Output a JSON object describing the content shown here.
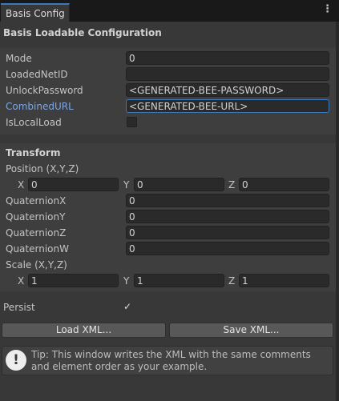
{
  "window": {
    "tab_title": "Basis Config",
    "menu_icon": "kebab-menu-icon"
  },
  "header": {
    "title": "Basis Loadable Configuration"
  },
  "loadable": {
    "mode_label": "Mode",
    "mode_value": "0",
    "net_id_label": "LoadedNetID",
    "net_id_value": "",
    "unlock_label": "UnlockPassword",
    "unlock_value": "<GENERATED-BEE-PASSWORD>",
    "url_label": "CombinedURL",
    "url_value": "<GENERATED-BEE-URL>",
    "local_label": "IsLocalLoad",
    "local_checked": false
  },
  "transform": {
    "title": "Transform",
    "position_label": "Position (X,Y,Z)",
    "position": {
      "x_label": "X",
      "x": "0",
      "y_label": "Y",
      "y": "0",
      "z_label": "Z",
      "z": "0"
    },
    "qx_label": "QuaternionX",
    "qx": "0",
    "qy_label": "QuaternionY",
    "qy": "0",
    "qz_label": "QuaternionZ",
    "qz": "0",
    "qw_label": "QuaternionW",
    "qw": "0",
    "scale_label": "Scale (X,Y,Z)",
    "scale": {
      "x_label": "X",
      "x": "1",
      "y_label": "Y",
      "y": "1",
      "z_label": "Z",
      "z": "1"
    }
  },
  "persist": {
    "label": "Persist",
    "checked": true,
    "check_glyph": "✓"
  },
  "buttons": {
    "load": "Load XML...",
    "save": "Save XML..."
  },
  "help": {
    "icon": "!",
    "text": "Tip: This window writes the XML with the same comments and element order as your example."
  },
  "colors": {
    "accent": "#3a79bb",
    "panel": "#383838",
    "field": "#2a2a2a",
    "label_active": "#7ea6e0"
  }
}
